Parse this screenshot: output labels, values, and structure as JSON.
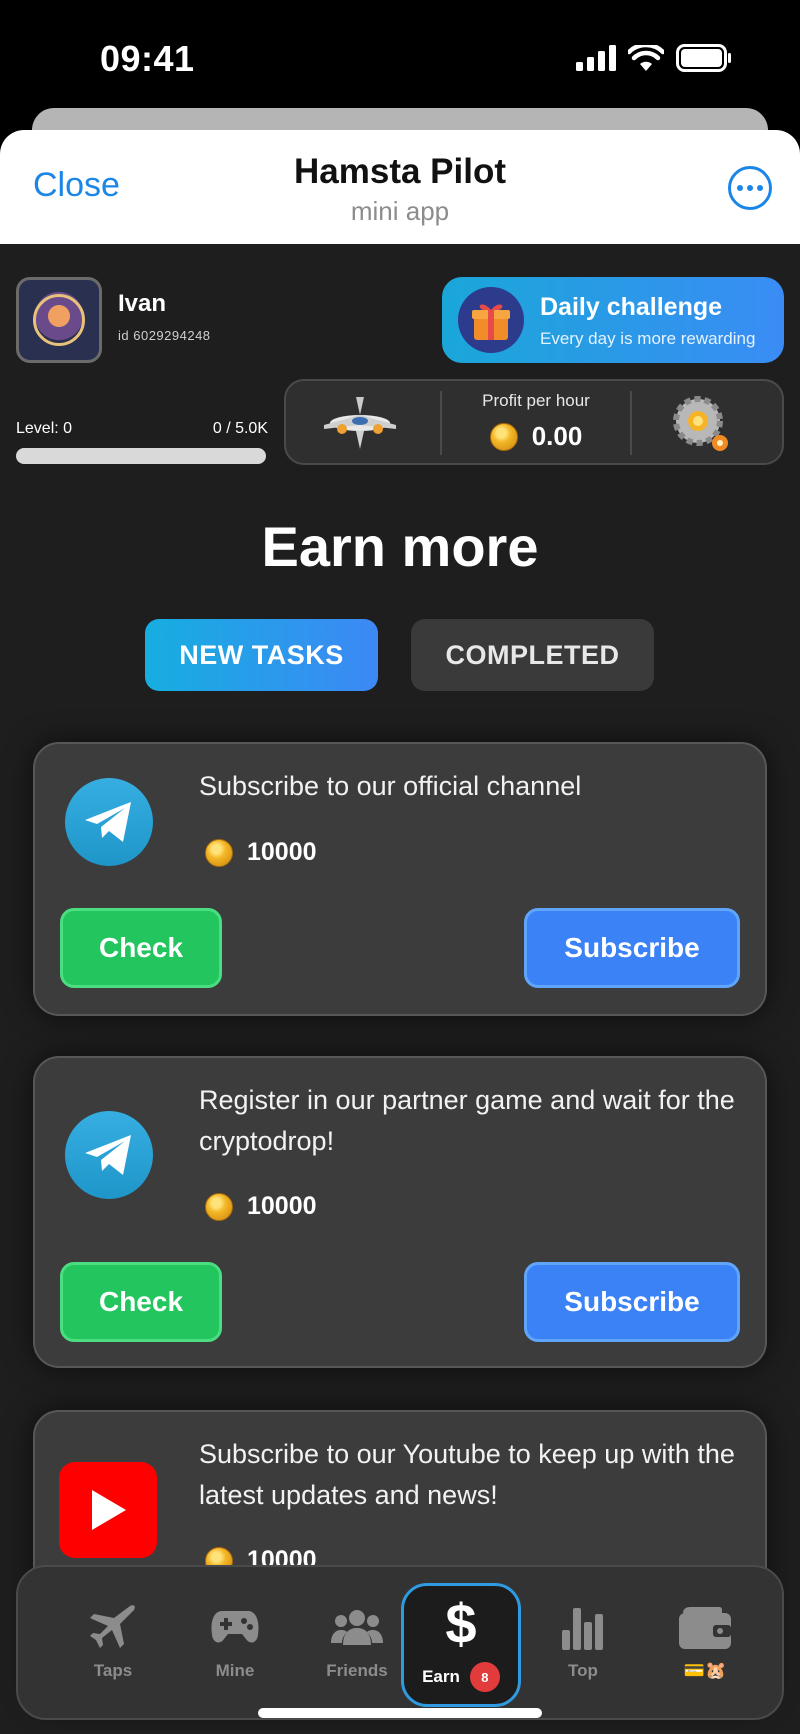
{
  "status_bar": {
    "time": "09:41"
  },
  "header": {
    "close_label": "Close",
    "title": "Hamsta Pilot",
    "subtitle": "mini app"
  },
  "user": {
    "name": "Ivan",
    "id_text": "id 6029294248"
  },
  "daily_challenge": {
    "title": "Daily challenge",
    "subtitle": "Every day is more rewarding"
  },
  "level": {
    "label": "Level: 0",
    "progress_text": "0 / 5.0K",
    "progress_fraction": 0.0
  },
  "profit": {
    "label": "Profit per hour",
    "value": "0.00"
  },
  "page": {
    "heading": "Earn more"
  },
  "tabs": {
    "new_label": "NEW TASKS",
    "completed_label": "COMPLETED",
    "active": "new"
  },
  "tasks": [
    {
      "icon": "telegram-icon",
      "text": "Subscribe to our official channel",
      "reward": "10000",
      "check_label": "Check",
      "action_label": "Subscribe"
    },
    {
      "icon": "telegram-icon",
      "text": "Register in our partner game and wait for the cryptodrop!",
      "reward": "10000",
      "check_label": "Check",
      "action_label": "Subscribe"
    },
    {
      "icon": "youtube-icon",
      "text": "Subscribe to our Youtube to keep up with the latest updates and news!",
      "reward": "10000"
    }
  ],
  "nav": {
    "items": [
      {
        "label": "Taps",
        "icon": "airplane-icon"
      },
      {
        "label": "Mine",
        "icon": "gamepad-icon"
      },
      {
        "label": "Friends",
        "icon": "friends-icon"
      },
      {
        "label": "Earn",
        "icon": "dollar-icon",
        "badge": "8"
      },
      {
        "label": "Top",
        "icon": "bar-chart-icon"
      },
      {
        "label": "💳🐹",
        "icon": "wallet-icon"
      }
    ]
  },
  "colors": {
    "accent_blue": "#3b82f6",
    "check_green": "#22c55e",
    "badge_red": "#e23b3b",
    "telegram_blue": "#1a86e8"
  }
}
